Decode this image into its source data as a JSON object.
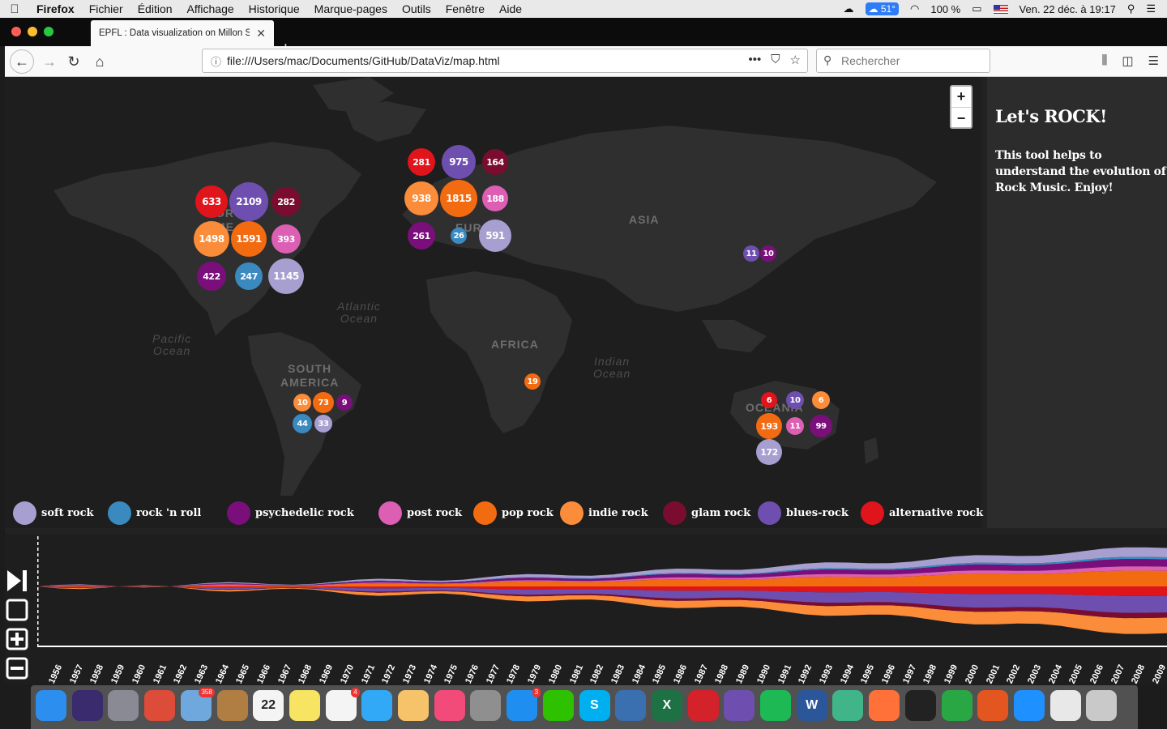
{
  "menubar": {
    "app": "Firefox",
    "items": [
      "Fichier",
      "Édition",
      "Affichage",
      "Historique",
      "Marque-pages",
      "Outils",
      "Fenêtre",
      "Aide"
    ],
    "temperature": "51°",
    "battery": "100 %",
    "datetime": "Ven. 22 déc. à 19:17"
  },
  "browser": {
    "tab_title": "EPFL : Data visualization on Millon S",
    "url": "file:///Users/mac/Documents/GitHub/DataViz/map.html",
    "search_placeholder": "Rechercher"
  },
  "map": {
    "labels": {
      "asia": "ASIA",
      "africa": "AFRICA",
      "south_america": "SOUTH\nAMERICA",
      "oceania": "OCEANIA",
      "north_america_partial": "OR\nME",
      "europe_partial": "EURO",
      "atlantic": "Atlantic\nOcean",
      "pacific": "Pacific\nOcean",
      "indian": "Indian\nOcean"
    },
    "clusters": [
      {
        "region": "north-america",
        "value": "633",
        "genre": "alternative rock"
      },
      {
        "region": "north-america",
        "value": "2109",
        "genre": "blues-rock"
      },
      {
        "region": "north-america",
        "value": "282",
        "genre": "glam rock"
      },
      {
        "region": "north-america",
        "value": "1498",
        "genre": "indie rock"
      },
      {
        "region": "north-america",
        "value": "1591",
        "genre": "pop rock"
      },
      {
        "region": "north-america",
        "value": "393",
        "genre": "post rock"
      },
      {
        "region": "north-america",
        "value": "422",
        "genre": "psychedelic rock"
      },
      {
        "region": "north-america",
        "value": "247",
        "genre": "rock 'n roll"
      },
      {
        "region": "north-america",
        "value": "1145",
        "genre": "soft rock"
      },
      {
        "region": "europe",
        "value": "281",
        "genre": "alternative rock"
      },
      {
        "region": "europe",
        "value": "975",
        "genre": "blues-rock"
      },
      {
        "region": "europe",
        "value": "164",
        "genre": "glam rock"
      },
      {
        "region": "europe",
        "value": "938",
        "genre": "indie rock"
      },
      {
        "region": "europe",
        "value": "1815",
        "genre": "pop rock"
      },
      {
        "region": "europe",
        "value": "188",
        "genre": "post rock"
      },
      {
        "region": "europe",
        "value": "261",
        "genre": "psychedelic rock"
      },
      {
        "region": "europe",
        "value": "26",
        "genre": "rock 'n roll"
      },
      {
        "region": "europe",
        "value": "591",
        "genre": "soft rock"
      },
      {
        "region": "asia",
        "value": "11",
        "genre": "blues-rock"
      },
      {
        "region": "asia",
        "value": "10",
        "genre": "psychedelic rock"
      },
      {
        "region": "africa",
        "value": "19",
        "genre": "pop rock"
      },
      {
        "region": "south-america",
        "value": "10",
        "genre": "indie rock"
      },
      {
        "region": "south-america",
        "value": "73",
        "genre": "pop rock"
      },
      {
        "region": "south-america",
        "value": "9",
        "genre": "psychedelic rock"
      },
      {
        "region": "south-america",
        "value": "44",
        "genre": "rock 'n roll"
      },
      {
        "region": "south-america",
        "value": "33",
        "genre": "soft rock"
      },
      {
        "region": "oceania",
        "value": "6",
        "genre": "alternative rock"
      },
      {
        "region": "oceania",
        "value": "10",
        "genre": "blues-rock"
      },
      {
        "region": "oceania",
        "value": "6",
        "genre": "indie rock"
      },
      {
        "region": "oceania",
        "value": "193",
        "genre": "pop rock"
      },
      {
        "region": "oceania",
        "value": "11",
        "genre": "post rock"
      },
      {
        "region": "oceania",
        "value": "99",
        "genre": "psychedelic rock"
      },
      {
        "region": "oceania",
        "value": "172",
        "genre": "soft rock"
      }
    ],
    "zoom": {
      "in": "+",
      "out": "−"
    }
  },
  "legend": [
    {
      "label": "soft rock",
      "color": "#a79fcf"
    },
    {
      "label": "rock 'n roll",
      "color": "#3a8ac0"
    },
    {
      "label": "psychedelic rock",
      "color": "#7a0f7b"
    },
    {
      "label": "post rock",
      "color": "#dc5fb4"
    },
    {
      "label": "pop rock",
      "color": "#f36b10"
    },
    {
      "label": "indie rock",
      "color": "#fb8c3a"
    },
    {
      "label": "glam rock",
      "color": "#7a0d2f"
    },
    {
      "label": "blues-rock",
      "color": "#6e4fb0"
    },
    {
      "label": "alternative rock",
      "color": "#e0141b"
    }
  ],
  "sidebar": {
    "title": "Let's ROCK!",
    "text": "This tool helps to understand the evolution of Rock Music. Enjoy!"
  },
  "timeline": {
    "years": [
      "1956",
      "1957",
      "1958",
      "1959",
      "1960",
      "1961",
      "1962",
      "1963",
      "1964",
      "1965",
      "1966",
      "1967",
      "1968",
      "1969",
      "1970",
      "1971",
      "1972",
      "1973",
      "1974",
      "1975",
      "1976",
      "1977",
      "1978",
      "1979",
      "1980",
      "1981",
      "1982",
      "1983",
      "1984",
      "1985",
      "1986",
      "1987",
      "1988",
      "1989",
      "1990",
      "1991",
      "1992",
      "1993",
      "1994",
      "1995",
      "1996",
      "1997",
      "1998",
      "1999",
      "2000",
      "2001",
      "2002",
      "2003",
      "2004",
      "2005",
      "2006",
      "2007",
      "2008",
      "2009"
    ],
    "controls": [
      "play-step",
      "stop",
      "zoom-in",
      "zoom-out"
    ]
  },
  "dock": {
    "apps": [
      {
        "name": "finder",
        "color": "#2c8ff0"
      },
      {
        "name": "siri",
        "color": "#3a2a6e"
      },
      {
        "name": "launchpad",
        "color": "#8a8a94"
      },
      {
        "name": "chrome",
        "color": "#dd4b39"
      },
      {
        "name": "mail-stamp",
        "color": "#6fa8dc",
        "badge": "358"
      },
      {
        "name": "contacts",
        "color": "#b07d43"
      },
      {
        "name": "calendar",
        "color": "#f4f4f4",
        "text": "22"
      },
      {
        "name": "notes",
        "color": "#f7e463"
      },
      {
        "name": "reminders",
        "color": "#f4f4f4",
        "badge": "4"
      },
      {
        "name": "messages",
        "color": "#32a9f6"
      },
      {
        "name": "photos",
        "color": "#f6c36b"
      },
      {
        "name": "music",
        "color": "#f24b7a"
      },
      {
        "name": "system-preferences",
        "color": "#8f8f8f"
      },
      {
        "name": "app-store",
        "color": "#1f8ef1",
        "badge": "3"
      },
      {
        "name": "wechat",
        "color": "#2dc100"
      },
      {
        "name": "skype",
        "color": "#00aff0",
        "text": "S"
      },
      {
        "name": "outline",
        "color": "#3a6fb0"
      },
      {
        "name": "excel",
        "color": "#1e7145",
        "text": "X"
      },
      {
        "name": "acrobat",
        "color": "#d3222a"
      },
      {
        "name": "github",
        "color": "#6e4fb0"
      },
      {
        "name": "spotify",
        "color": "#1db954"
      },
      {
        "name": "word",
        "color": "#2b579a",
        "text": "W"
      },
      {
        "name": "atom",
        "color": "#3fb589"
      },
      {
        "name": "firefox",
        "color": "#ff7139"
      },
      {
        "name": "terminal",
        "color": "#222222"
      },
      {
        "name": "activity",
        "color": "#29a745"
      },
      {
        "name": "matlab",
        "color": "#e4561f"
      },
      {
        "name": "safari",
        "color": "#1e90ff"
      },
      {
        "name": "document",
        "color": "#e8e8e8"
      },
      {
        "name": "trash",
        "color": "#c9c9c9"
      }
    ]
  }
}
